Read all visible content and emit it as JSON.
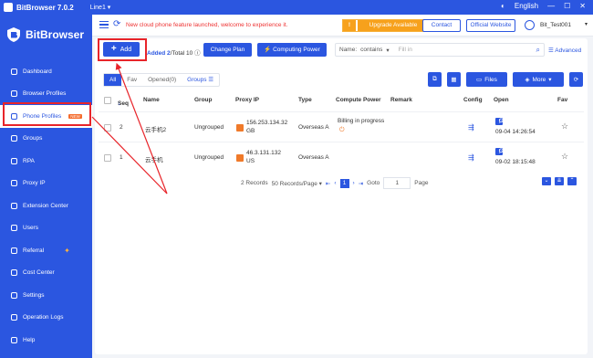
{
  "titlebar": {
    "app_name": "BitBrowser 7.0.2",
    "line": "Line1 ▾",
    "language": "English"
  },
  "sidebar": {
    "brand": "BitBrowser",
    "items": [
      {
        "label": "Dashboard",
        "icon": "home-icon"
      },
      {
        "label": "Browser Profiles",
        "icon": "browser-icon"
      },
      {
        "label": "Phone Profiles",
        "icon": "cloud-icon",
        "badge": "NEW",
        "active": true
      },
      {
        "label": "Groups",
        "icon": "groups-icon"
      },
      {
        "label": "RPA",
        "icon": "rpa-icon"
      },
      {
        "label": "Proxy IP",
        "icon": "proxy-icon"
      },
      {
        "label": "Extension Center",
        "icon": "extension-icon"
      },
      {
        "label": "Users",
        "icon": "users-icon"
      },
      {
        "label": "Referral",
        "icon": "referral-icon"
      },
      {
        "label": "Cost Center",
        "icon": "cost-icon"
      },
      {
        "label": "Settings",
        "icon": "gear-icon"
      },
      {
        "label": "Operation Logs",
        "icon": "logs-icon"
      },
      {
        "label": "Help",
        "icon": "help-icon"
      }
    ]
  },
  "topbar": {
    "notice": "New cloud phone feature launched, welcome to experience it.",
    "upgrade_label": "Upgrade Available",
    "contact_label": "Contact",
    "website_label": "Official Website",
    "user_name": "Bit_Test001"
  },
  "toolbar": {
    "add_label": "Add",
    "added_prefix": "Added",
    "added_count": "2",
    "total_text": "/Total 10",
    "change_plan_label": "Change Plan",
    "computing_power_label": "Computing Power",
    "search_field_label": "Name:",
    "search_mode": "contains",
    "search_placeholder": "Fill in",
    "advanced_label": "Advanced"
  },
  "filters": {
    "all": "All",
    "fav": "Fav",
    "opened": "Opened(0)",
    "groups": "Groups"
  },
  "actions": {
    "files_label": "Files",
    "more_label": "More"
  },
  "table": {
    "headers": {
      "seq": "Seq",
      "name": "Name",
      "group": "Group",
      "proxy_ip": "Proxy IP",
      "type": "Type",
      "compute_power": "Compute Power",
      "remark": "Remark",
      "config": "Config",
      "open": "Open",
      "fav": "Fav"
    },
    "rows": [
      {
        "seq": "2",
        "name": "云手机2",
        "group": "Ungrouped",
        "proxy_ip": "156.253.134.32",
        "proxy_country": "GB",
        "type": "Overseas A",
        "compute_power": "Billing in progress",
        "open_label": "Open",
        "opened_at": "09-04 14:26:54"
      },
      {
        "seq": "1",
        "name": "云手机",
        "group": "Ungrouped",
        "proxy_ip": "46.3.131.132",
        "proxy_country": "US",
        "type": "Overseas A",
        "compute_power": "",
        "open_label": "Open",
        "opened_at": "09-02 18:15:48"
      }
    ]
  },
  "pagination": {
    "records": "2 Records",
    "per_page": "50 Records/Page ▾",
    "current_page": "1",
    "goto_label": "Goto",
    "goto_value": "1",
    "page_suffix": "Page"
  },
  "colors": {
    "brand": "#2b56e0",
    "upgrade": "#f7a11c",
    "highlight": "#e8242a"
  }
}
